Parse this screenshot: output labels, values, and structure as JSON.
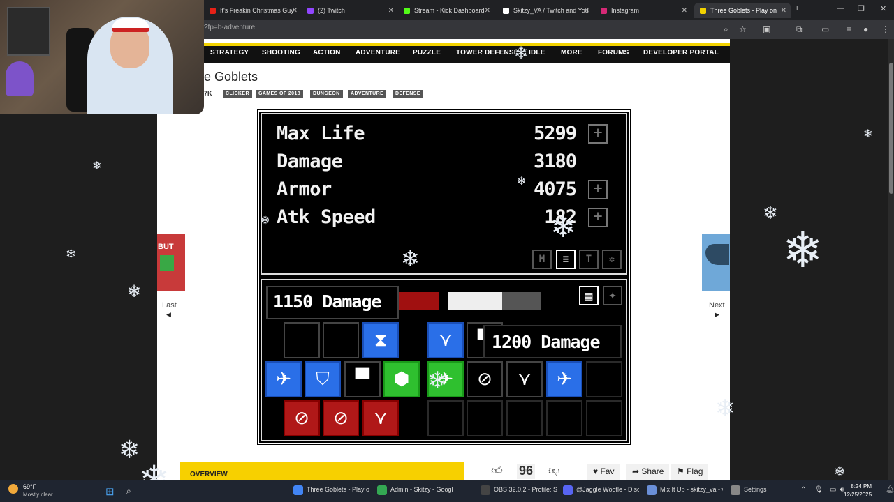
{
  "browser": {
    "tabs": [
      {
        "label": "It's Freakin Christmas Guy",
        "color": "#e62117"
      },
      {
        "label": "(2) Twitch",
        "color": "#9146ff"
      },
      {
        "label": "Stream - Kick Dashboard",
        "color": "#53fc18"
      },
      {
        "label": "Skitzy_VA / Twitch and You",
        "color": "#ffffff"
      },
      {
        "label": "Instagram",
        "color": "#d62976"
      },
      {
        "label": "Three Goblets - Play on",
        "color": "#f2d200"
      }
    ],
    "url": "?fp=b-adventure",
    "new_tab": "+",
    "minimize": "—",
    "maximize": "❐",
    "close": "✕"
  },
  "site": {
    "nav": [
      "STRATEGY",
      "SHOOTING",
      "ACTION",
      "ADVENTURE",
      "PUZZLE",
      "TOWER DEFENSE",
      "IDLE",
      "MORE",
      "FORUMS",
      "DEVELOPER PORTAL"
    ],
    "game_title": "e Goblets",
    "plays": "7K",
    "tags": [
      "CLICKER",
      "GAMES OF 2018",
      "DUNGEON",
      "ADVENTURE",
      "DEFENSE"
    ],
    "last_label": "Last",
    "next_label": "Next",
    "thumb_left_text": "BUT",
    "overview_label": "OVERVIEW",
    "like_count": "96",
    "fav_label": "Fav",
    "share_label": "Share",
    "flag_label": "Flag"
  },
  "game": {
    "stats": [
      {
        "label": "Max Life",
        "value": "5299",
        "plus": true
      },
      {
        "label": "Damage",
        "value": "3180",
        "plus": false
      },
      {
        "label": "Armor",
        "value": "4075",
        "plus": true
      },
      {
        "label": "Atk Speed",
        "value": "182",
        "plus": true
      }
    ],
    "plus_glyph": "+",
    "tab_buttons": [
      "M",
      "≡",
      "T",
      "✲"
    ],
    "damage_box": "1150 Damage",
    "tooltip": "1200 Damage",
    "health_bar_fraction": 0.58,
    "grid_icon": "▦",
    "gear_icon": "✦",
    "slots_row1": [
      {
        "type": "plain",
        "icon": ""
      },
      {
        "type": "plain",
        "icon": ""
      },
      {
        "type": "blue",
        "icon": "⧗"
      },
      {
        "type": "blue",
        "icon": "⋎"
      },
      {
        "type": "plain",
        "icon": "▘"
      }
    ],
    "slots_row2": [
      {
        "type": "blue",
        "icon": "✈"
      },
      {
        "type": "blue",
        "icon": "⛉"
      },
      {
        "type": "plain",
        "icon": "▀"
      },
      {
        "type": "green",
        "icon": "⬢"
      },
      {
        "type": "green",
        "icon": "✈"
      },
      {
        "type": "plain",
        "icon": "⊘"
      },
      {
        "type": "plain",
        "icon": "⋎"
      },
      {
        "type": "blue",
        "icon": "✈"
      },
      {
        "type": "empty",
        "icon": ""
      }
    ],
    "slots_row3": [
      {
        "type": "red",
        "icon": "⊘"
      },
      {
        "type": "red",
        "icon": "⊘"
      },
      {
        "type": "red",
        "icon": "⋎"
      },
      {
        "type": "empty",
        "icon": ""
      },
      {
        "type": "empty",
        "icon": ""
      },
      {
        "type": "empty",
        "icon": ""
      },
      {
        "type": "empty",
        "icon": ""
      },
      {
        "type": "empty",
        "icon": ""
      }
    ]
  },
  "taskbar": {
    "weather_temp": "69°F",
    "weather_desc": "Mostly clear",
    "apps": [
      {
        "label": "Three Goblets - Play on",
        "color": "#4285f4"
      },
      {
        "label": "Admin - Skitzy - Google",
        "color": "#34a853"
      },
      {
        "label": "OBS 32.0.2 - Profile: Stre",
        "color": "#444444"
      },
      {
        "label": "@Jaggle Woofle - Disco",
        "color": "#5865f2"
      },
      {
        "label": "Mix It Up - skitzy_va - v",
        "color": "#6a8fd8"
      },
      {
        "label": "Settings",
        "color": "#888888"
      }
    ],
    "time": "8:24 PM",
    "date": "12/25/2025"
  }
}
